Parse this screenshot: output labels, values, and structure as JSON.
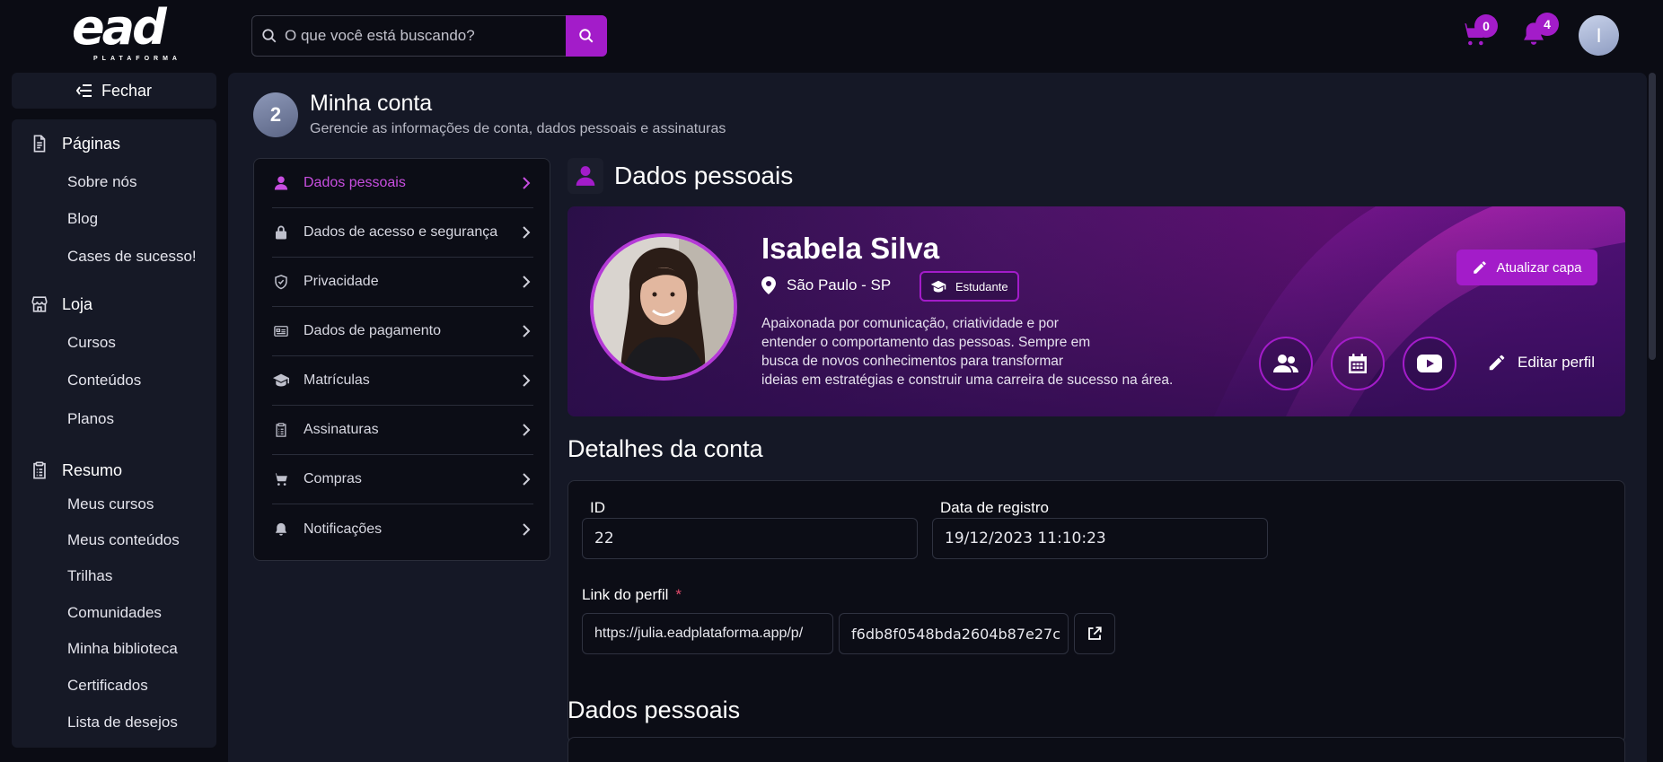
{
  "app": {
    "logo_text": "ead",
    "logo_sub": "PLATAFORMA",
    "search_placeholder": "O que você está buscando?",
    "cart_count": "0",
    "notifications_count": "4",
    "user_initial": "I"
  },
  "sidebar": {
    "close_label": "Fechar",
    "sections": [
      {
        "title": "Páginas",
        "icon": "document-icon",
        "items": [
          "Sobre nós",
          "Blog",
          "Cases de sucesso!"
        ]
      },
      {
        "title": "Loja",
        "icon": "store-icon",
        "items": [
          "Cursos",
          "Conteúdos",
          "Planos"
        ]
      },
      {
        "title": "Resumo",
        "icon": "clipboard-icon",
        "items": [
          "Meus cursos",
          "Meus conteúdos",
          "Trilhas",
          "Comunidades",
          "Minha biblioteca",
          "Certificados",
          "Lista de desejos"
        ]
      }
    ]
  },
  "page": {
    "number": "2",
    "title": "Minha conta",
    "subtitle": "Gerencie as informações de conta, dados pessoais e assinaturas"
  },
  "account_menu": [
    {
      "label": "Dados pessoais",
      "icon": "person-icon",
      "active": true
    },
    {
      "label": "Dados de acesso e segurança",
      "icon": "lock-icon",
      "active": false
    },
    {
      "label": "Privacidade",
      "icon": "shield-icon",
      "active": false
    },
    {
      "label": "Dados de pagamento",
      "icon": "payment-card-icon",
      "active": false
    },
    {
      "label": "Matrículas",
      "icon": "graduation-cap-icon",
      "active": false
    },
    {
      "label": "Assinaturas",
      "icon": "clipboard-list-icon",
      "active": false
    },
    {
      "label": "Compras",
      "icon": "cart-icon",
      "active": false
    },
    {
      "label": "Notificações",
      "icon": "bell-icon",
      "active": false
    }
  ],
  "profile": {
    "section_title": "Dados pessoais",
    "name": "Isabela Silva",
    "location": "São Paulo - SP",
    "role": "Estudante",
    "bio_lines": [
      "Apaixonada por comunicação, criatividade e por",
      "entender o comportamento das pessoas. Sempre em",
      "busca de novos conhecimentos para transformar",
      "ideias em estratégias e construir uma carreira de sucesso na área."
    ],
    "update_cover_label": "Atualizar capa",
    "edit_profile_label": "Editar perfil"
  },
  "account_details": {
    "title": "Detalhes da conta",
    "id_label": "ID",
    "id_value": "22",
    "reg_label": "Data de registro",
    "reg_value": "19/12/2023 11:10:23",
    "link_label": "Link do perfil",
    "link_required": "*",
    "link_prefix": "https://julia.eadplataforma.app/p/",
    "link_slug": "f6db8f0548bda2604b87e27c"
  },
  "personal_data": {
    "title": "Dados pessoais"
  },
  "colors": {
    "accent": "#a31cc9",
    "active_text": "#c84ee0",
    "background": "#0b0c14",
    "panel": "#151826"
  }
}
